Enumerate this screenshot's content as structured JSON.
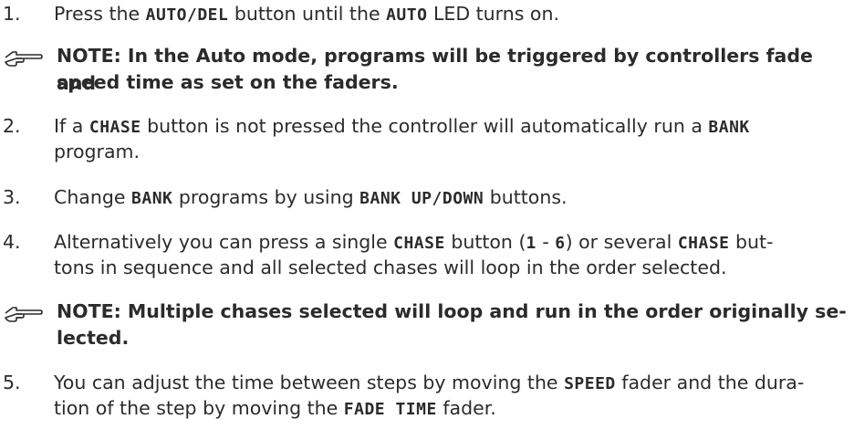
{
  "items": [
    {
      "num": "1.",
      "parts": [
        "Press the ",
        "AUTO/DEL",
        " button until the ",
        "AUTO",
        " LED turns on."
      ]
    },
    {
      "note": "NOTE: In the Auto mode, programs will be triggered by controllers fade and",
      "note_cont": "speed time as set on the faders."
    },
    {
      "num": "2.",
      "parts": [
        "If a ",
        "CHASE",
        " button is not pressed the controller will automatically run a ",
        "BANK"
      ],
      "cont": "program."
    },
    {
      "num": "3.",
      "parts": [
        "Change ",
        "BANK",
        " programs by using ",
        "BANK UP/DOWN",
        " buttons."
      ]
    },
    {
      "num": "4.",
      "parts": [
        "Alternatively you can press a single ",
        "CHASE",
        " button (",
        "1",
        " - ",
        "6",
        ") or several ",
        "CHASE",
        " but-"
      ],
      "cont": "tons in sequence and all selected chases will loop in the order selected."
    },
    {
      "note": "NOTE: Multiple chases selected will loop and run in the order originally se-",
      "note_cont": "lected."
    },
    {
      "num": "5.",
      "parts": [
        "You can adjust the time between steps by moving the ",
        "SPEED",
        " fader and the dura-"
      ],
      "cont_parts": [
        "tion of the step by moving the ",
        "FADE TIME",
        " fader."
      ]
    }
  ],
  "icons": {
    "note_icon": "pointing-hand-icon"
  }
}
